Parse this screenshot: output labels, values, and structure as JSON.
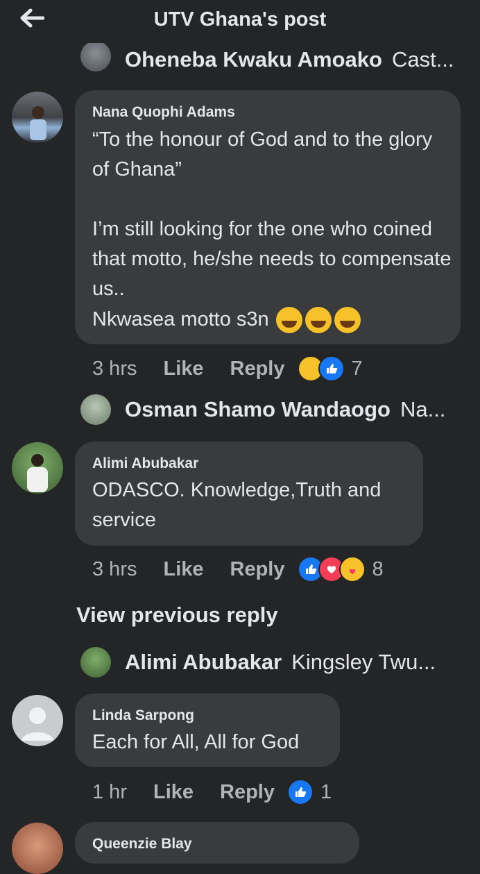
{
  "header": {
    "title": "UTV Ghana's post"
  },
  "comments": [
    {
      "replyPreview": {
        "name": "Oheneba Kwaku Amoako",
        "text": "Cast..."
      }
    },
    {
      "name": "Nana Quophi Adams",
      "text": "“To the honour of God and to the glory of Ghana”\n\nI’m still looking for the one who coined that motto, he/she needs to compensate us..",
      "text2": "Nkwasea motto s3n",
      "time": "3 hrs",
      "like": "Like",
      "reply": "Reply",
      "count": "7",
      "reactions": [
        "haha",
        "like"
      ]
    },
    {
      "replyPreview": {
        "name": "Osman Shamo Wandaogo",
        "text": "Na..."
      }
    },
    {
      "name": "Alimi Abubakar",
      "text": "ODASCO. Knowledge,Truth and service",
      "time": "3 hrs",
      "like": "Like",
      "reply": "Reply",
      "count": "8",
      "reactions": [
        "like",
        "love",
        "care"
      ]
    },
    {
      "viewPrevious": "View previous reply"
    },
    {
      "replyPreview": {
        "name": "Alimi Abubakar",
        "text": "Kingsley Twu..."
      }
    },
    {
      "name": "Linda Sarpong",
      "text": "Each for All, All for God",
      "time": "1 hr",
      "like": "Like",
      "reply": "Reply",
      "count": "1",
      "reactions": [
        "like"
      ]
    },
    {
      "name": "Queenzie Blay"
    }
  ],
  "colors": {
    "background": "#242526",
    "bubble": "#3a3b3c",
    "like": "#1877f2",
    "love": "#f33e58",
    "haha": "#f7c12a"
  }
}
